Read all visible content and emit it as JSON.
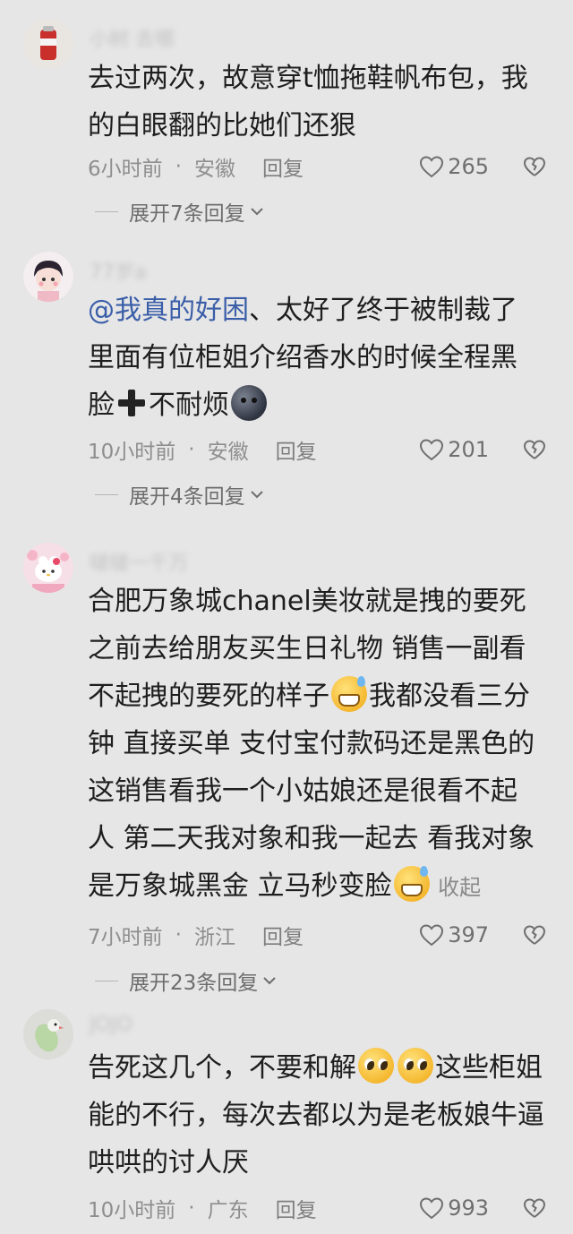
{
  "comments": [
    {
      "username": "小树 去哪",
      "segments": [
        {
          "type": "text",
          "text": "去过两次，故意穿t恤拖鞋帆布包，我\n的白眼翻的比她们还狠"
        }
      ],
      "time": "6小时前",
      "location": "安徽",
      "reply_label": "回复",
      "likes": "265",
      "expand_label": "展开7条回复"
    },
    {
      "username": "77岁a",
      "segments": [
        {
          "type": "mention",
          "text": "@我真的好困"
        },
        {
          "type": "text",
          "text": "、太好了终于被制裁了\n里面有位柜姐介绍香水的时候全程黑\n脸"
        },
        {
          "type": "icon",
          "icon": "heavy-plus-icon"
        },
        {
          "type": "text",
          "text": "不耐烦"
        },
        {
          "type": "icon",
          "icon": "dark-face-emoji"
        }
      ],
      "time": "10小时前",
      "location": "安徽",
      "reply_label": "回复",
      "likes": "201",
      "expand_label": "展开4条回复"
    },
    {
      "username": "啵啵一千万",
      "segments": [
        {
          "type": "text",
          "text": "合肥万象城chanel美妆就是拽的要死\n之前去给朋友买生日礼物 销售一副看\n不起拽的要死的样子"
        },
        {
          "type": "icon",
          "icon": "grin-sweat-emoji"
        },
        {
          "type": "text",
          "text": "我都没看三分\n钟 直接买单 支付宝付款码还是黑色的\n这销售看我一个小姑娘还是很看不起\n人 第二天我对象和我一起去 看我对象\n是万象城黑金 立马秒变脸"
        },
        {
          "type": "icon",
          "icon": "grin-sweat-emoji"
        },
        {
          "type": "collapse",
          "text": " 收起"
        }
      ],
      "time": "7小时前",
      "location": "浙江",
      "reply_label": "回复",
      "likes": "397",
      "expand_label": "展开23条回复"
    },
    {
      "username": "JOJO",
      "segments": [
        {
          "type": "text",
          "text": "告死这几个，不要和解"
        },
        {
          "type": "icon",
          "icon": "pleading-face-emoji"
        },
        {
          "type": "icon",
          "icon": "pleading-face-emoji"
        },
        {
          "type": "text",
          "text": "这些柜姐\n能的不行，每次去都以为是老板娘牛逼\n哄哄的讨人厌"
        }
      ],
      "time": "10小时前",
      "location": "广东",
      "reply_label": "回复",
      "likes": "993",
      "expand_label": ""
    }
  ],
  "dot_separator": "·",
  "colors": {
    "background": "#e6e6e6",
    "mention": "#3a5ea8",
    "meta": "#8e8e8e"
  }
}
